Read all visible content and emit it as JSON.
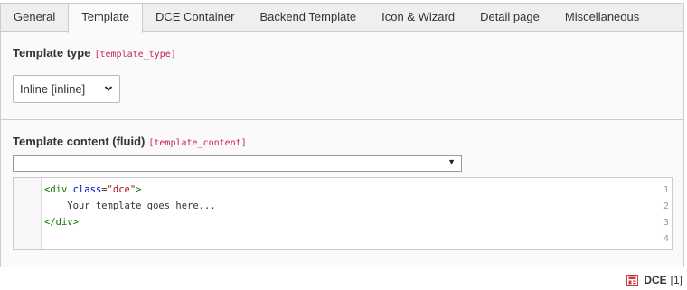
{
  "tabs": [
    {
      "label": "General",
      "active": false
    },
    {
      "label": "Template",
      "active": true
    },
    {
      "label": "DCE Container",
      "active": false
    },
    {
      "label": "Backend Template",
      "active": false
    },
    {
      "label": "Icon & Wizard",
      "active": false
    },
    {
      "label": "Detail page",
      "active": false
    },
    {
      "label": "Miscellaneous",
      "active": false
    }
  ],
  "template_type": {
    "label": "Template type",
    "key": "[template_type]",
    "selected": "Inline [inline]"
  },
  "template_content": {
    "label": "Template content (fluid)",
    "key": "[template_content]",
    "selected": "",
    "lines": [
      {
        "number": "1",
        "tag_open": "<div ",
        "attr": "class",
        "eq": "=",
        "str": "\"dce\"",
        "tag_close": ">",
        "text": ""
      },
      {
        "number": "2",
        "tag_open": "",
        "attr": "",
        "eq": "",
        "str": "",
        "tag_close": "",
        "text": "    Your template goes here..."
      },
      {
        "number": "3",
        "tag_open": "</div>",
        "attr": "",
        "eq": "",
        "str": "",
        "tag_close": "",
        "text": ""
      },
      {
        "number": "4",
        "tag_open": "",
        "attr": "",
        "eq": "",
        "str": "",
        "tag_close": "",
        "text": ""
      }
    ]
  },
  "record": {
    "icon": "record-icon",
    "name": "DCE",
    "uid": "[1]"
  },
  "colors": {
    "key_text": "#c7254e",
    "tag": "#117700",
    "attribute": "#0000cc",
    "string": "#aa1111",
    "record_icon": "#c83c3c"
  }
}
